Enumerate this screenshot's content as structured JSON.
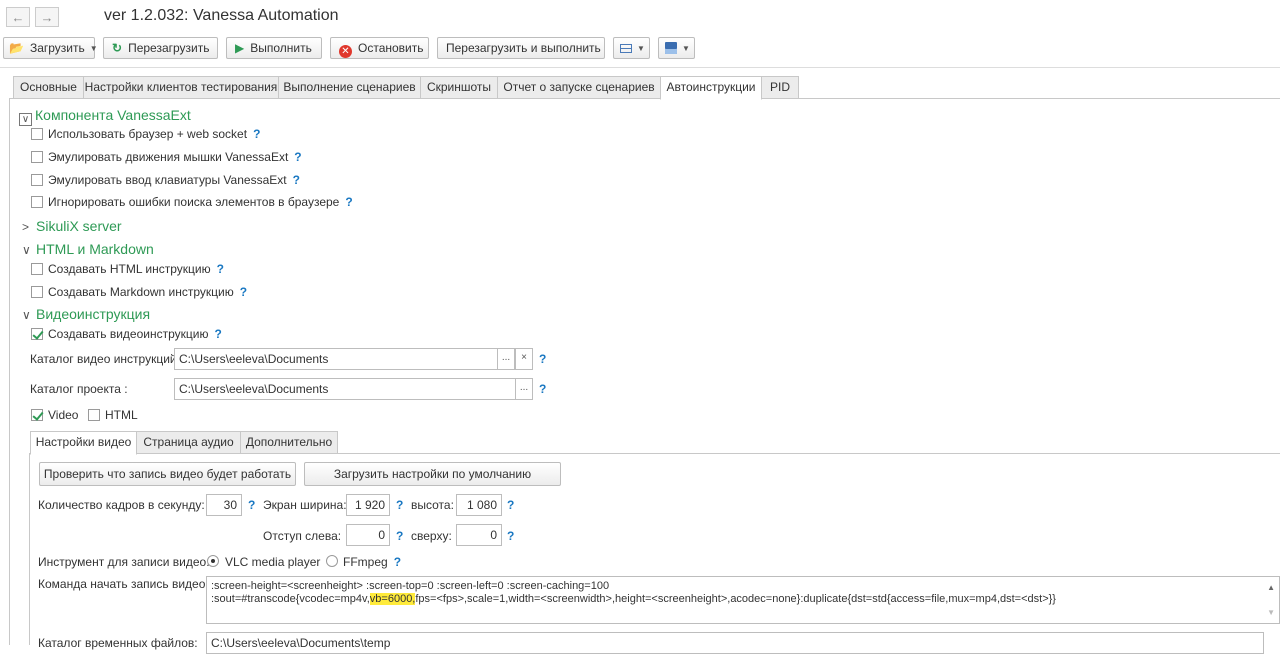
{
  "window": {
    "title": "ver 1.2.032: Vanessa Automation"
  },
  "toolbar": {
    "load": "Загрузить",
    "reload": "Перезагрузить",
    "run": "Выполнить",
    "stop": "Остановить",
    "reload_run": "Перезагрузить и выполнить"
  },
  "tabs": [
    "Основные",
    "Настройки клиентов тестирования",
    "Выполнение сценариев",
    "Скриншоты",
    "Отчет о запуске сценариев",
    "Автоинструкции",
    "PID"
  ],
  "groups": {
    "vanessaext": {
      "title": "Компонента VanessaExt",
      "items": [
        "Использовать браузер + web socket",
        "Эмулировать движения мышки VanessaExt",
        "Эмулировать ввод клавиатуры VanessaExt",
        "Игнорировать ошибки поиска элементов в браузере"
      ]
    },
    "sikulix": {
      "title": "SikuliX server"
    },
    "html_md": {
      "title": "HTML и Markdown",
      "items": [
        "Создавать HTML инструкцию",
        "Создавать Markdown инструкцию"
      ]
    },
    "video": {
      "title": "Видеоинструкция",
      "create": "Создавать видеоинструкцию",
      "catalog_label": "Каталог видео инструкций:",
      "catalog_value": "C:\\Users\\eeleva\\Documents",
      "project_label": "Каталог проекта :",
      "project_value": "C:\\Users\\eeleva\\Documents",
      "video_check": "Video",
      "html_check": "HTML"
    }
  },
  "inner_tabs": [
    "Настройки видео",
    "Страница аудио",
    "Дополнительно"
  ],
  "video_settings": {
    "check_btn": "Проверить что запись видео будет работать",
    "defaults_btn": "Загрузить настройки по умолчанию",
    "fps_label": "Количество кадров в секунду:",
    "fps_value": "30",
    "width_label": "Экран ширина:",
    "width_value": "1 920",
    "height_label": "высота:",
    "height_value": "1 080",
    "left_label": "Отступ слева:",
    "left_value": "0",
    "top_label": "сверху:",
    "top_value": "0",
    "tool_label": "Инструмент для записи видео:",
    "tool_vlc": "VLC media player",
    "tool_ffmpeg": "FFmpeg",
    "cmd_label": "Команда начать запись видео:",
    "cmd_line1": ":screen-height=<screenheight> :screen-top=0 :screen-left=0 :screen-caching=100",
    "cmd_line2_a": ":sout=#transcode{vcodec=mp4v,",
    "cmd_line2_hl": "vb=6000,",
    "cmd_line2_b": "fps=<fps>,scale=1,width=<screenwidth>,height=<screenheight>,acodec=none}:duplicate{dst=std{access=file,mux=mp4,dst=<dst>}}",
    "temp_label": "Каталог временных файлов:",
    "temp_value": "C:\\Users\\eeleva\\Documents\\temp"
  },
  "ui": {
    "help": "?",
    "ellipsis": "...",
    "clear": "×"
  }
}
